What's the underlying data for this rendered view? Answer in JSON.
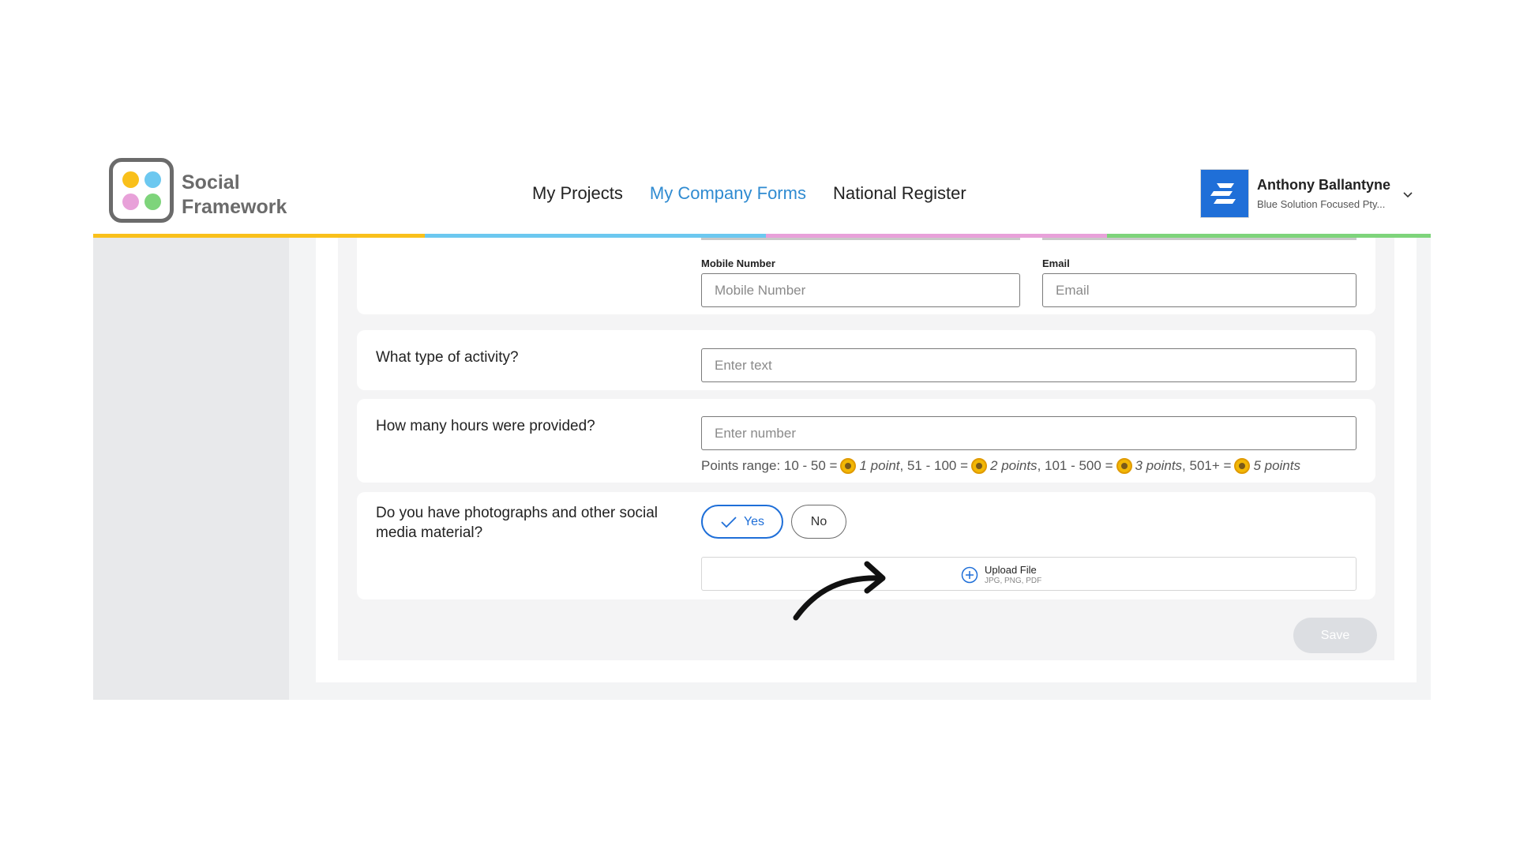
{
  "brand": {
    "line1": "Social",
    "line2": "Framework"
  },
  "nav": {
    "items": [
      {
        "label": "My Projects"
      },
      {
        "label": "My Company Forms"
      },
      {
        "label": "National Register"
      }
    ],
    "active": "My Company Forms"
  },
  "user": {
    "name": "Anthony Ballantyne",
    "company": "Blue Solution Focused Pty..."
  },
  "contact": {
    "mobile_label": "Mobile Number",
    "mobile_placeholder": "Mobile Number",
    "email_label": "Email",
    "email_placeholder": "Email"
  },
  "activity": {
    "question": "What type of activity?",
    "placeholder": "Enter text"
  },
  "hours": {
    "question": "How many hours were provided?",
    "placeholder": "Enter number",
    "points_prefix": "Points range: 10 - 50 =",
    "p1": "1 point",
    "r2": ", 51 - 100 =",
    "p2": "2 points",
    "r3": ", 101 - 500 =",
    "p3": "3 points",
    "r4": ", 501+ =",
    "p4": "5 points"
  },
  "media": {
    "question": "Do you have photographs and other social media material?",
    "yes_label": "Yes",
    "no_label": "No",
    "selected": "Yes",
    "upload_title": "Upload File",
    "upload_types": "JPG, PNG, PDF"
  },
  "actions": {
    "save_label": "Save"
  },
  "colors": {
    "accent": "#2f8bd1",
    "selected_blue": "#1f6fd8",
    "stripe": [
      "#f9c01b",
      "#6cc8f0",
      "#e8a1d9",
      "#7ed47b"
    ]
  }
}
